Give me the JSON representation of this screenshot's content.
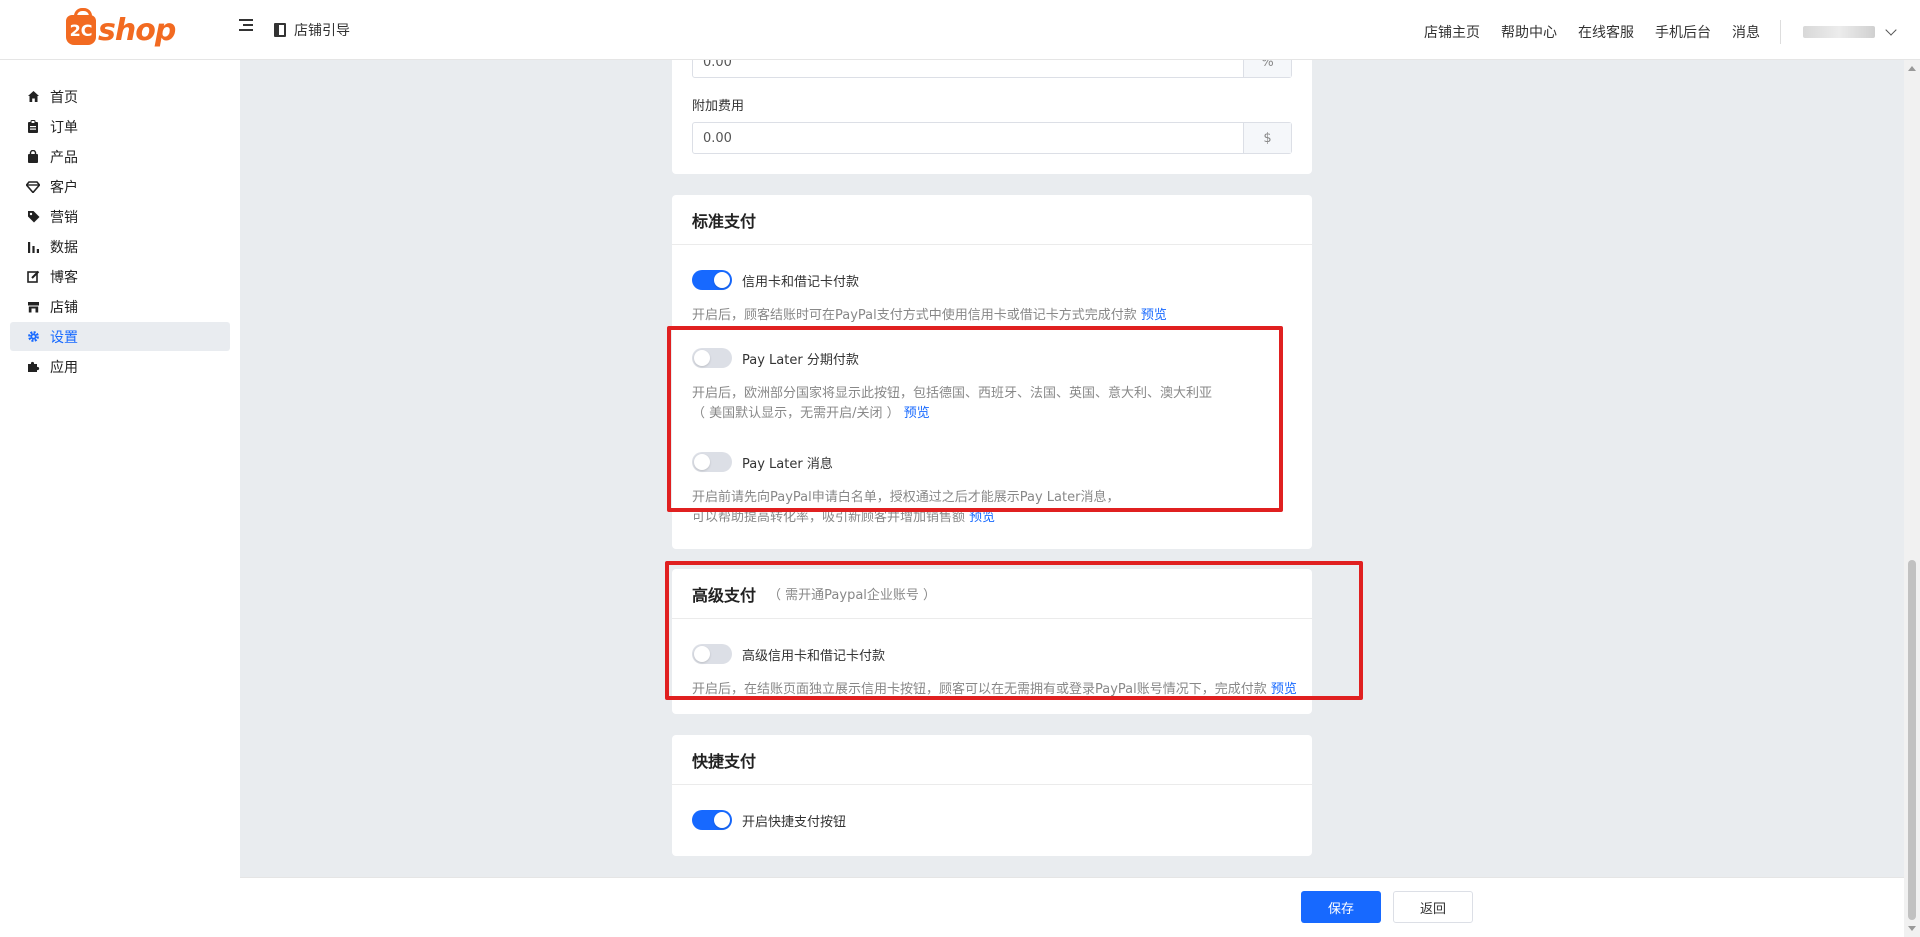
{
  "header": {
    "logo_mark": "2C",
    "logo_word": "shop",
    "guide_label": "店铺引导",
    "links": [
      "店铺主页",
      "帮助中心",
      "在线客服",
      "手机后台",
      "消息"
    ]
  },
  "sidebar": {
    "items": [
      {
        "label": "首页",
        "icon": "home-icon"
      },
      {
        "label": "订单",
        "icon": "clipboard-icon"
      },
      {
        "label": "产品",
        "icon": "bag-icon"
      },
      {
        "label": "客户",
        "icon": "diamond-icon"
      },
      {
        "label": "营销",
        "icon": "tag-icon"
      },
      {
        "label": "数据",
        "icon": "bar-chart-icon"
      },
      {
        "label": "博客",
        "icon": "edit-icon"
      },
      {
        "label": "店铺",
        "icon": "store-icon"
      },
      {
        "label": "设置",
        "icon": "gear-icon",
        "active": true
      },
      {
        "label": "应用",
        "icon": "puzzle-icon"
      }
    ]
  },
  "fees": {
    "percent_value": "0.00",
    "percent_unit": "%",
    "extra_label": "附加费用",
    "extra_value": "0.00",
    "extra_unit": "$"
  },
  "standard": {
    "title": "标准支付",
    "card_toggle_label": "信用卡和借记卡付款",
    "card_toggle_on": true,
    "card_desc": "开启后，顾客结账时可在PayPal支付方式中使用信用卡或借记卡方式完成付款",
    "card_preview": "预览",
    "paylater_label": "Pay Later 分期付款",
    "paylater_on": false,
    "paylater_desc_1": "开启后，欧洲部分国家将显示此按钮，包括德国、西班牙、法国、英国、意大利、澳大利亚",
    "paylater_desc_2": "（ 美国默认显示，无需开启/关闭 ）",
    "paylater_preview": "预览",
    "msg_label": "Pay Later 消息",
    "msg_on": false,
    "msg_desc_1": "开启前请先向PayPal申请白名单，授权通过之后才能展示Pay Later消息，",
    "msg_desc_2": "可以帮助提高转化率，吸引新顾客并增加销售额",
    "msg_preview": "预览"
  },
  "advanced": {
    "title": "高级支付",
    "subtitle": "（ 需开通Paypal企业账号 ）",
    "toggle_label": "高级信用卡和借记卡付款",
    "toggle_on": false,
    "desc": "开启后，在结账页面独立展示信用卡按钮，顾客可以在无需拥有或登录PayPal账号情况下，完成付款",
    "preview": "预览"
  },
  "express": {
    "title": "快捷支付",
    "toggle_label": "开启快捷支付按钮",
    "toggle_on": true
  },
  "footer": {
    "save_label": "保存",
    "back_label": "返回"
  },
  "colors": {
    "accent": "#1769ff",
    "brand": "#f26a21",
    "highlight": "#e02020"
  }
}
